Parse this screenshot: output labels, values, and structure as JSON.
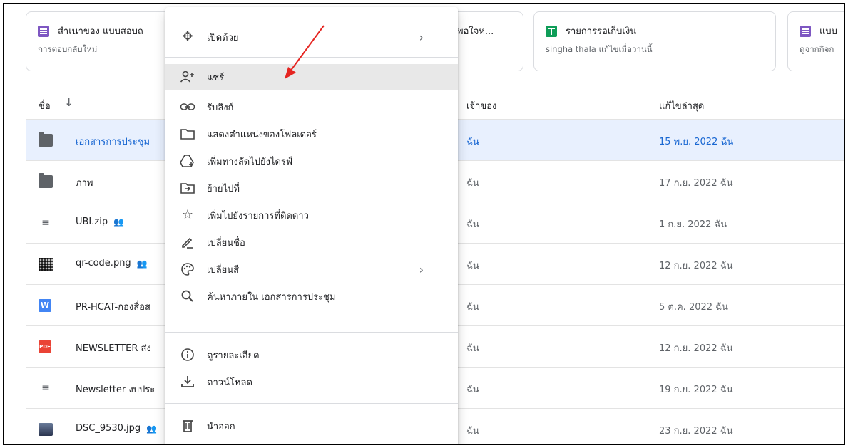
{
  "cards": [
    {
      "title": "สำเนาของ แบบสอบถ",
      "subtitle": "การตอบกลับใหม่",
      "icon": "forms-icon"
    },
    {
      "title": "พอใจห...",
      "subtitle": "",
      "icon": ""
    },
    {
      "title": "รายการรอเก็บเงิน",
      "subtitle": "singha thala แก้ไขเมื่อวานนี้",
      "icon": "sheets-icon"
    },
    {
      "title": "แบบ",
      "subtitle": "ดูจากกิจก",
      "icon": "forms-icon"
    }
  ],
  "table": {
    "headers": {
      "name": "ชื่อ",
      "owner": "เจ้าของ",
      "modified": "แก้ไขล่าสุด"
    },
    "rows": [
      {
        "name": "เอกสารการประชุม",
        "owner": "ฉัน",
        "modified": "15 พ.ย. 2022 ฉัน",
        "icon": "folder-icon",
        "shared": false
      },
      {
        "name": "ภาพ",
        "owner": "ฉัน",
        "modified": "17 ก.ย. 2022 ฉัน",
        "icon": "shared-folder-icon",
        "shared": false
      },
      {
        "name": "UBI.zip",
        "owner": "ฉัน",
        "modified": "1 ก.ย. 2022 ฉัน",
        "icon": "zip-icon",
        "shared": true
      },
      {
        "name": "qr-code.png",
        "owner": "ฉัน",
        "modified": "12 ก.ย. 2022 ฉัน",
        "icon": "image-icon",
        "shared": true
      },
      {
        "name": "PR-HCAT-กองสื่อส",
        "owner": "ฉัน",
        "modified": "5 ต.ค. 2022 ฉัน",
        "icon": "word-icon",
        "shared": false
      },
      {
        "name": "NEWSLETTER ส่ง",
        "owner": "ฉัน",
        "modified": "12 ก.ย. 2022 ฉัน",
        "icon": "pdf-icon",
        "shared": false
      },
      {
        "name": "Newsletter งบประ",
        "owner": "ฉัน",
        "modified": "19 ก.ย. 2022 ฉัน",
        "icon": "zip-icon",
        "shared": false
      },
      {
        "name": "DSC_9530.jpg",
        "owner": "ฉัน",
        "modified": "23 ก.ย. 2022 ฉัน",
        "icon": "photo-icon",
        "shared": true
      }
    ]
  },
  "menu": {
    "items": [
      {
        "label": "เปิดด้วย",
        "icon": "move-icon",
        "submenu": true
      },
      {
        "label": "แชร์",
        "icon": "person-add-icon",
        "highlighted": true
      },
      {
        "label": "รับลิงก์",
        "icon": "link-icon"
      },
      {
        "label": "แสดงตำแหน่งของโฟลเดอร์",
        "icon": "folder-outline-icon"
      },
      {
        "label": "เพิ่มทางลัดไปยังไดรฟ์",
        "icon": "add-shortcut-icon"
      },
      {
        "label": "ย้ายไปที่",
        "icon": "move-to-icon"
      },
      {
        "label": "เพิ่มไปยังรายการที่ติดดาว",
        "icon": "star-icon"
      },
      {
        "label": "เปลี่ยนชื่อ",
        "icon": "pencil-icon"
      },
      {
        "label": "เปลี่ยนสี",
        "icon": "palette-icon",
        "submenu": true
      },
      {
        "label": "ค้นหาภายใน เอกสารการประชุม",
        "icon": "search-icon"
      },
      {
        "label": "ดูรายละเอียด",
        "icon": "info-icon"
      },
      {
        "label": "ดาวน์โหลด",
        "icon": "download-icon"
      },
      {
        "label": "นำออก",
        "icon": "trash-icon"
      }
    ],
    "chevron": "›"
  },
  "colors": {
    "selected_row": "#e8f0fe",
    "selected_text": "#1967d2",
    "annotation_arrow": "#e52521",
    "menu_highlight": "#e8e8e8"
  }
}
